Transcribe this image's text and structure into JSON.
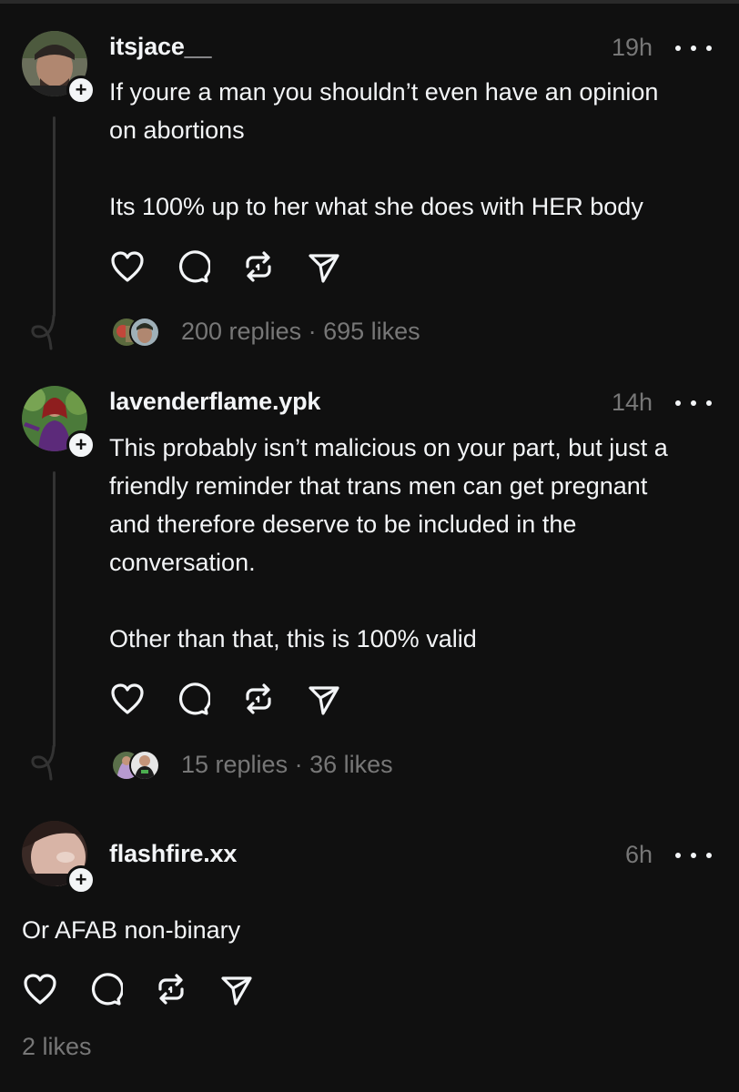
{
  "posts": [
    {
      "username": "itsjace__",
      "time": "19h",
      "text": "If youre a man you shouldn’t even have an opinion\non abortions\n\nIts 100% up to her what she does with HER body",
      "stats": "200 replies · 695 likes"
    },
    {
      "username": "lavenderflame.ypk",
      "time": "14h",
      "text": "This probably isn’t malicious on your part, but just a\nfriendly reminder that trans men can get pregnant\nand therefore deserve to be included in the\nconversation.\n\nOther than that, this is 100% valid",
      "stats": "15 replies · 36 likes"
    },
    {
      "username": "flashfire.xx",
      "time": "6h",
      "text": "Or AFAB non-binary",
      "stats": "2 likes"
    }
  ],
  "icons": {
    "like": "heart-icon",
    "reply": "comment-icon",
    "repost": "repost-icon",
    "share": "send-icon",
    "more": "more-icon",
    "follow": "plus-icon"
  },
  "colors": {
    "background": "#101010",
    "text": "#f3f5f7",
    "muted": "#777777"
  }
}
